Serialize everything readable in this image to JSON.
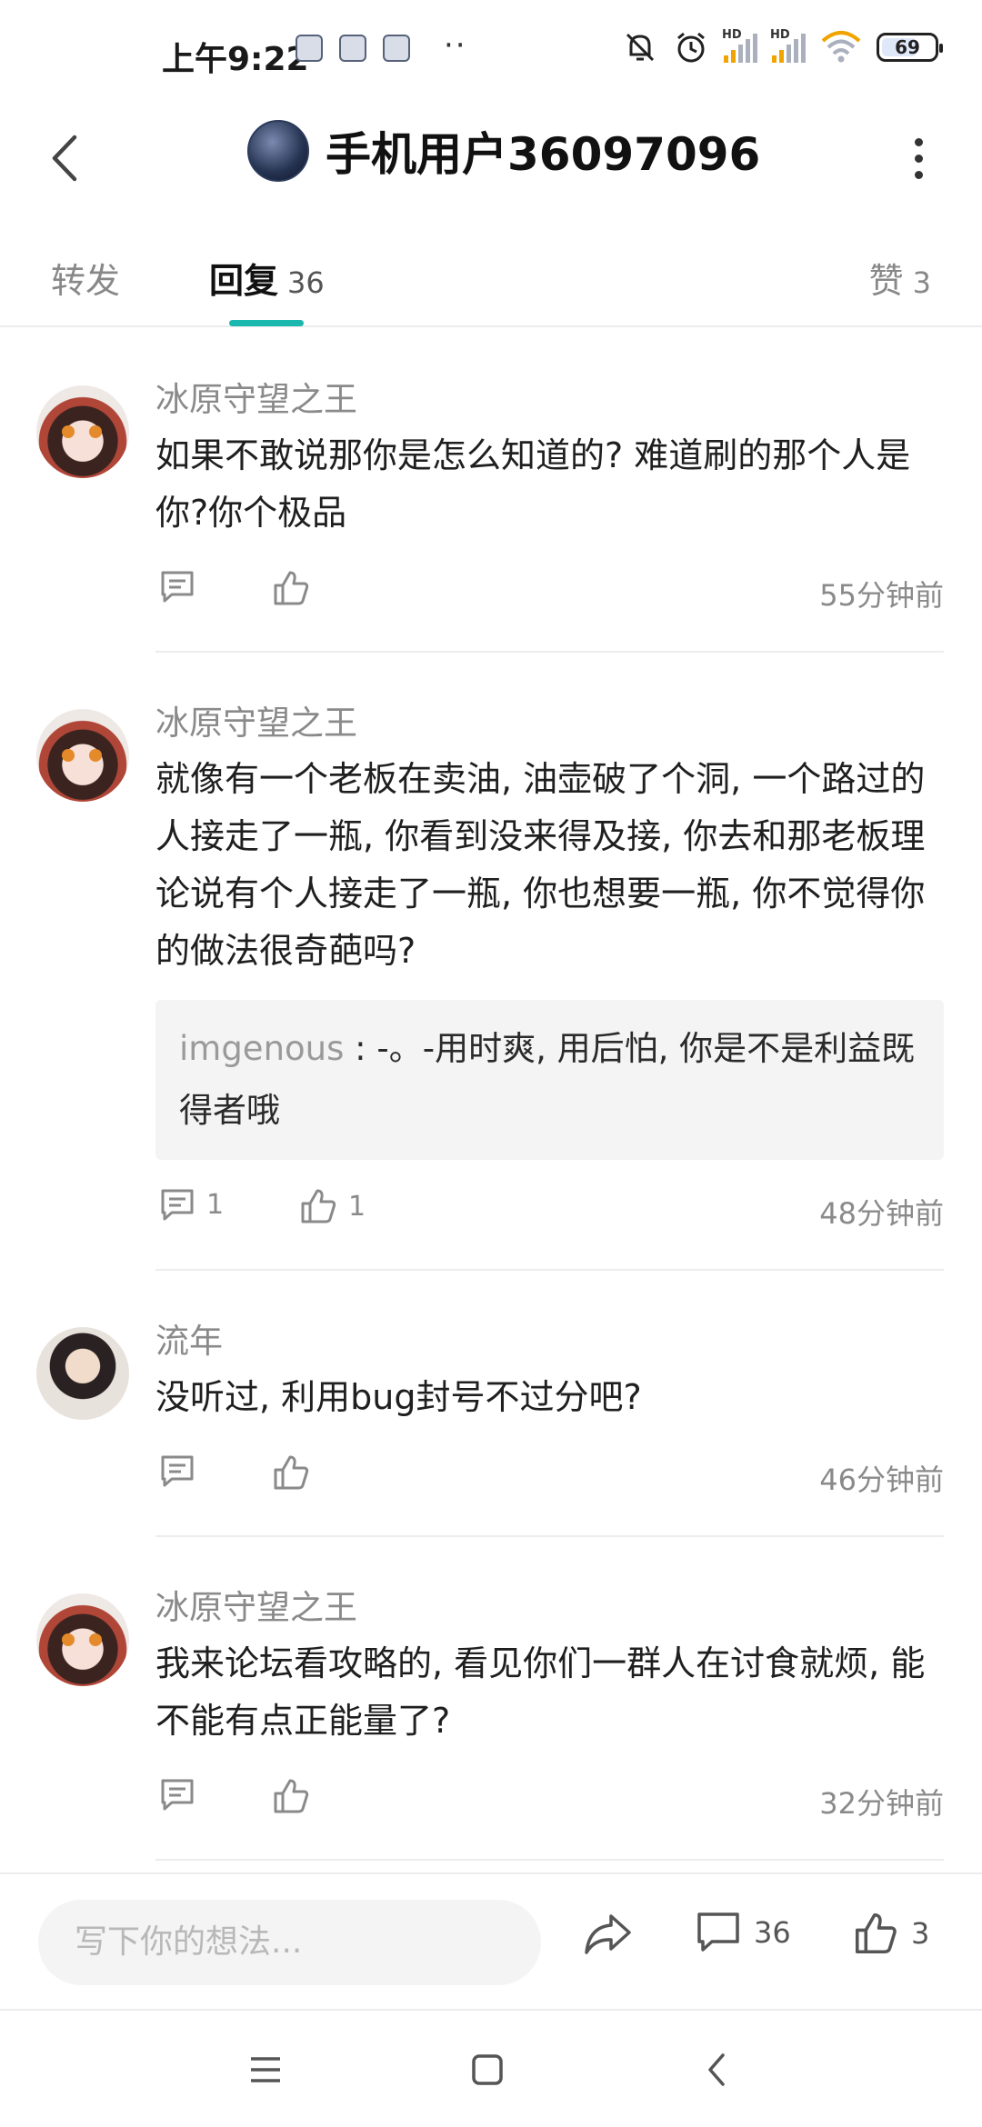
{
  "status_bar": {
    "time": "上午9:22",
    "more": "··",
    "battery": "69",
    "signal_label": "HD"
  },
  "header": {
    "title": "手机用户36097096"
  },
  "tabs": [
    {
      "label": "转发",
      "count": ""
    },
    {
      "label": "回复",
      "count": "36"
    },
    {
      "label": "赞",
      "count": "3"
    }
  ],
  "comments": [
    {
      "name": "冰原守望之王",
      "text": "如果不敢说那你是怎么知道的? 难道刷的那个人是你?你个极品",
      "reply_count": "",
      "like_count": "",
      "time": "55分钟前"
    },
    {
      "name": "冰原守望之王",
      "text": "就像有一个老板在卖油, 油壶破了个洞, 一个路过的人接走了一瓶, 你看到没来得及接, 你去和那老板理论说有个人接走了一瓶, 你也想要一瓶, 你不觉得你的做法很奇葩吗?",
      "quote": {
        "name": "imgenous",
        "sep": " : ",
        "text": "-。-用时爽, 用后怕, 你是不是利益既得者哦"
      },
      "reply_count": "1",
      "like_count": "1",
      "time": "48分钟前"
    },
    {
      "name": "流年",
      "text": "没听过, 利用bug封号不过分吧?",
      "reply_count": "",
      "like_count": "",
      "time": "46分钟前"
    },
    {
      "name": "冰原守望之王",
      "text": "我来论坛看攻略的, 看见你们一群人在讨食就烦, 能不能有点正能量了?",
      "reply_count": "",
      "like_count": "",
      "time": "32分钟前"
    }
  ],
  "bottom_bar": {
    "input_placeholder": "写下你的想法...",
    "comment_count": "36",
    "like_count": "3"
  },
  "colors": {
    "accent": "#1bb8b0",
    "muted": "#8a8a8a"
  }
}
